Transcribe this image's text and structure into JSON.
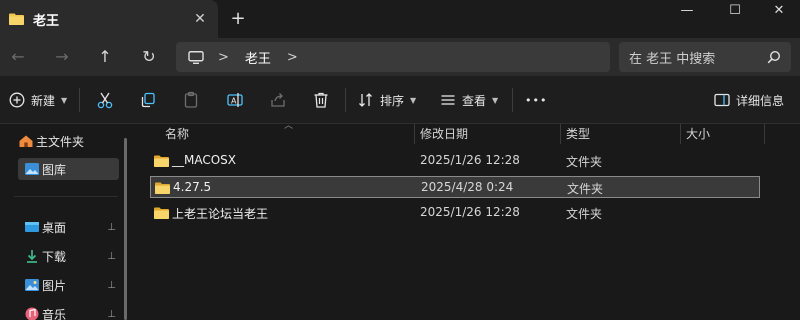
{
  "window": {
    "tab_title": "老王",
    "tab_close": "✕",
    "new_tab": "+",
    "minimize": "—",
    "maximize": "☐",
    "close": "✕"
  },
  "nav": {
    "back": "←",
    "forward": "→",
    "up": "↑",
    "refresh": "↻",
    "breadcrumb": [
      "老王"
    ],
    "chevron": ">",
    "search_placeholder": "在 老王 中搜索"
  },
  "toolbar": {
    "new_label": "新建",
    "sort_label": "排序",
    "view_label": "查看",
    "more": "•••",
    "details_label": "详细信息"
  },
  "sidebar": {
    "items": [
      {
        "label": "主文件夹",
        "icon": "home-icon"
      },
      {
        "label": "图库",
        "icon": "gallery-icon"
      },
      {
        "label": "桌面",
        "icon": "desktop-icon",
        "pinned": true
      },
      {
        "label": "下载",
        "icon": "download-icon",
        "pinned": true
      },
      {
        "label": "图片",
        "icon": "pictures-icon",
        "pinned": true
      },
      {
        "label": "音乐",
        "icon": "music-icon",
        "pinned": true
      }
    ],
    "pin": "📌"
  },
  "columns": {
    "name": "名称",
    "date": "修改日期",
    "type": "类型",
    "size": "大小"
  },
  "files": [
    {
      "name": "__MACOSX",
      "date": "2025/1/26 12:28",
      "type": "文件夹"
    },
    {
      "name": "4.27.5",
      "date": "2025/4/28 0:24",
      "type": "文件夹",
      "selected": true
    },
    {
      "name": "上老王论坛当老王",
      "date": "2025/1/26 12:28",
      "type": "文件夹"
    }
  ],
  "colors": {
    "folder": "#f3c64c",
    "accent_blue": "#4cc2ff",
    "background": "#191919"
  }
}
